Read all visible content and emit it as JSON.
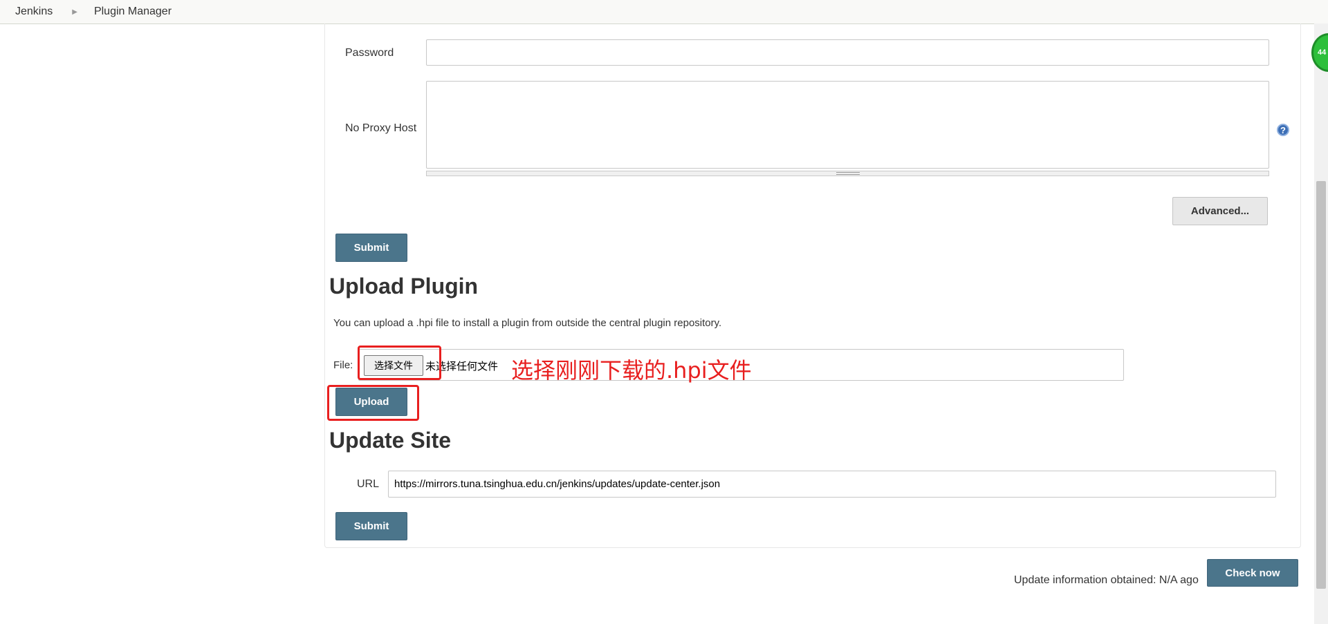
{
  "breadcrumb": {
    "root": "Jenkins",
    "current": "Plugin Manager"
  },
  "proxy": {
    "password_label": "Password",
    "password_value": "",
    "no_proxy_label": "No Proxy Host",
    "no_proxy_value": "",
    "help_glyph": "?",
    "advanced_label": "Advanced...",
    "submit_label": "Submit"
  },
  "upload": {
    "heading": "Upload Plugin",
    "description": "You can upload a .hpi file to install a plugin from outside the central plugin repository.",
    "file_label": "File:",
    "choose_button": "选择文件",
    "no_file_text": "未选择任何文件",
    "annotation": "选择刚刚下载的.hpi文件",
    "upload_label": "Upload"
  },
  "update_site": {
    "heading": "Update Site",
    "url_label": "URL",
    "url_value": "https://mirrors.tuna.tsinghua.edu.cn/jenkins/updates/update-center.json",
    "submit_label": "Submit"
  },
  "footer": {
    "update_info": "Update information obtained: N/A ago",
    "check_now_label": "Check now"
  },
  "side_badge": {
    "text": "44"
  },
  "colors": {
    "primary_button": "#4b758b",
    "annotation_red": "#e81f1f",
    "help_blue": "#3d6fb6"
  },
  "icons": {
    "breadcrumb_separator": "triangle-right-icon",
    "help": "question-circle-icon"
  }
}
